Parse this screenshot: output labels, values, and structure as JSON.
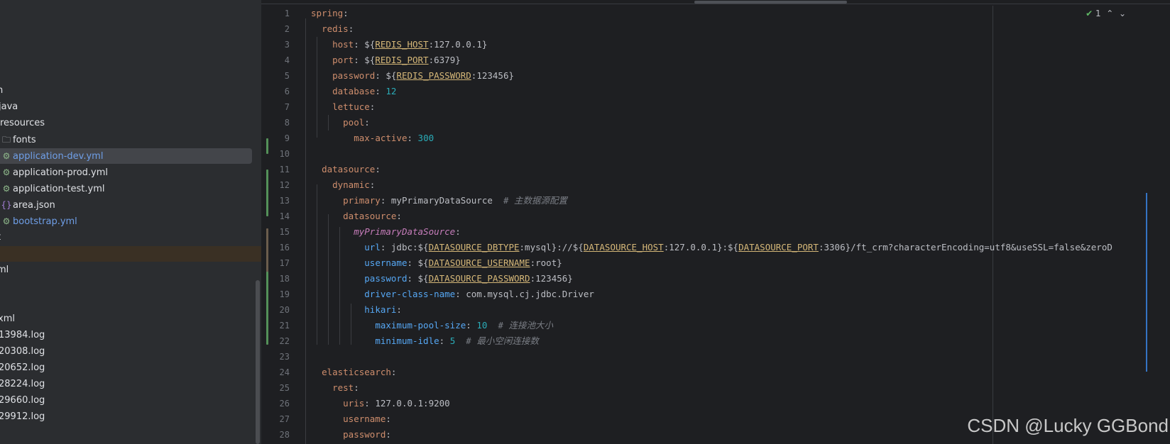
{
  "sidebar": {
    "items": [
      {
        "label": "n",
        "icon": "none"
      },
      {
        "label": "java",
        "icon": "none"
      },
      {
        "label": "resources",
        "icon": "none"
      },
      {
        "label": "fonts",
        "icon": "folder-icon"
      },
      {
        "label": "application-dev.yml",
        "icon": "yaml-file-icon"
      },
      {
        "label": "application-prod.yml",
        "icon": "yaml-file-icon"
      },
      {
        "label": "application-test.yml",
        "icon": "yaml-file-icon"
      },
      {
        "label": "area.json",
        "icon": "json-file-icon"
      },
      {
        "label": "bootstrap.yml",
        "icon": "yaml-file-icon"
      },
      {
        "label": "t",
        "icon": "none"
      },
      {
        "label": "",
        "icon": "none"
      },
      {
        "label": "ml",
        "icon": "none"
      },
      {
        "label": "xml",
        "icon": "none"
      },
      {
        "label": "13984.log",
        "icon": "none"
      },
      {
        "label": "20308.log",
        "icon": "none"
      },
      {
        "label": "20652.log",
        "icon": "none"
      },
      {
        "label": "28224.log",
        "icon": "none"
      },
      {
        "label": "29660.log",
        "icon": "none"
      },
      {
        "label": "29912.log",
        "icon": "none"
      }
    ]
  },
  "editor": {
    "inspection": {
      "count": "1"
    },
    "line_numbers": [
      "1",
      "2",
      "3",
      "4",
      "5",
      "6",
      "7",
      "8",
      "9",
      "10",
      "11",
      "12",
      "13",
      "14",
      "15",
      "16",
      "17",
      "18",
      "19",
      "20",
      "21",
      "22",
      "23",
      "24",
      "25",
      "26",
      "27",
      "28"
    ]
  },
  "watermark": "CSDN @Lucky GGBond",
  "colors": {
    "keyword": "#cf8e6d",
    "key_blue": "#56a8f5",
    "env": "#d5b778",
    "number": "#2aacb8",
    "comment": "#7a7e85",
    "background": "#1e1f22"
  }
}
